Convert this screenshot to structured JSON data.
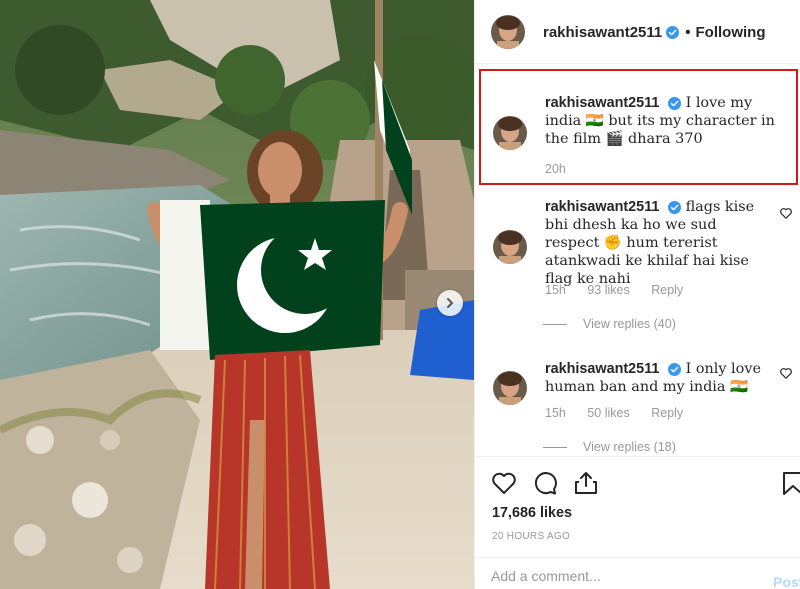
{
  "post": {
    "username": "rakhisawant2511",
    "follow_status": "Following",
    "dot": "•",
    "likes_count": "17,686 likes",
    "posted_time": "20 HOURS AGO",
    "add_comment_placeholder": "Add a comment...",
    "post_label": "Post"
  },
  "comments": [
    {
      "username": "rakhisawant2511",
      "text": "I love my india 🇮🇳 but its my character in the film 🎬 dhara 370",
      "time": "20h",
      "highlighted": true
    },
    {
      "username": "rakhisawant2511",
      "text": "flags kise bhi dhesh ka ho we sud respect ✊ hum tererist atankwadi ke khilaf hai kise flag ke nahi",
      "time": "15h",
      "likes": "93 likes",
      "reply": "Reply",
      "view_replies": "View replies (40)"
    },
    {
      "username": "rakhisawant2511",
      "text": "I only love human ban and my india 🇮🇳",
      "time": "15h",
      "likes": "50 likes",
      "reply": "Reply",
      "view_replies": "View replies (18)"
    }
  ],
  "icons": {
    "verified": "verified-badge-icon",
    "like": "heart-icon",
    "comment": "comment-bubble-icon",
    "share": "share-icon",
    "save": "bookmark-icon",
    "next": "chevron-right-icon"
  },
  "colors": {
    "verified_blue": "#3897f0",
    "highlight_red": "#d41818",
    "flag_green": "#01411c",
    "post_button": "#b3dbff"
  }
}
